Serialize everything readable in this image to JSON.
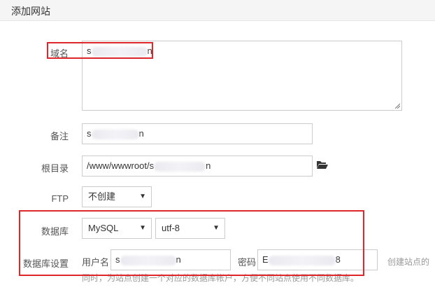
{
  "dialog": {
    "title": "添加网站"
  },
  "form": {
    "domain": {
      "label": "域名",
      "value_start": "s",
      "value_end": "n"
    },
    "remark": {
      "label": "备注",
      "value_start": "s",
      "value_end": "n"
    },
    "root": {
      "label": "根目录",
      "value_start": "/www/wwwroot/s",
      "value_end": "n",
      "icon": "folder-open-icon"
    },
    "ftp": {
      "label": "FTP",
      "selected": "不创建"
    },
    "database": {
      "label": "数据库",
      "type_selected": "MySQL",
      "charset_selected": "utf-8"
    },
    "db_settings": {
      "label": "数据库设置",
      "username_label": "用户名",
      "username_start": "s",
      "username_end": "n",
      "password_label": "密码",
      "password_start": "E",
      "password_end": "8",
      "hint_line1": "创建站点的",
      "hint_line2": "同时，为站点创建一个对应的数据库帐户，方便不同站点使用不同数据库。"
    }
  },
  "colors": {
    "highlight_box": "#e0262b",
    "border": "#cccccc",
    "title_bg": "#f5f5f5"
  }
}
